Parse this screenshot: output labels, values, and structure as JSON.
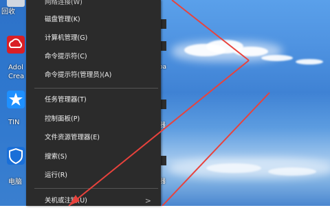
{
  "desktop": {
    "icons": [
      {
        "name": "recycle-bin",
        "label": "回收"
      },
      {
        "name": "adobe-creative-cloud",
        "label": "Adol",
        "label2": "Crea"
      },
      {
        "name": "tim",
        "label": "TIN"
      },
      {
        "name": "tencent-pc-manager",
        "label": "电脑"
      }
    ],
    "right_fragments": [
      "oa",
      "器",
      "器"
    ]
  },
  "menu": {
    "items": [
      {
        "label": "网络连接(W)"
      },
      {
        "label": "磁盘管理(K)"
      },
      {
        "label": "计算机管理(G)"
      },
      {
        "label": "命令提示符(C)"
      },
      {
        "label": "命令提示符(管理员)(A)"
      },
      {
        "label": "任务管理器(T)"
      },
      {
        "label": "控制面板(P)"
      },
      {
        "label": "文件资源管理器(E)"
      },
      {
        "label": "搜索(S)"
      },
      {
        "label": "运行(R)"
      },
      {
        "label": "关机或注销(U)",
        "submenu_arrow": ">"
      }
    ]
  },
  "colors": {
    "menu_bg": "#2b2b2b",
    "menu_text": "#f2f2f2",
    "separator": "#555555",
    "annotation_arrow": "#e8423c",
    "sky": "#4f93e1"
  }
}
